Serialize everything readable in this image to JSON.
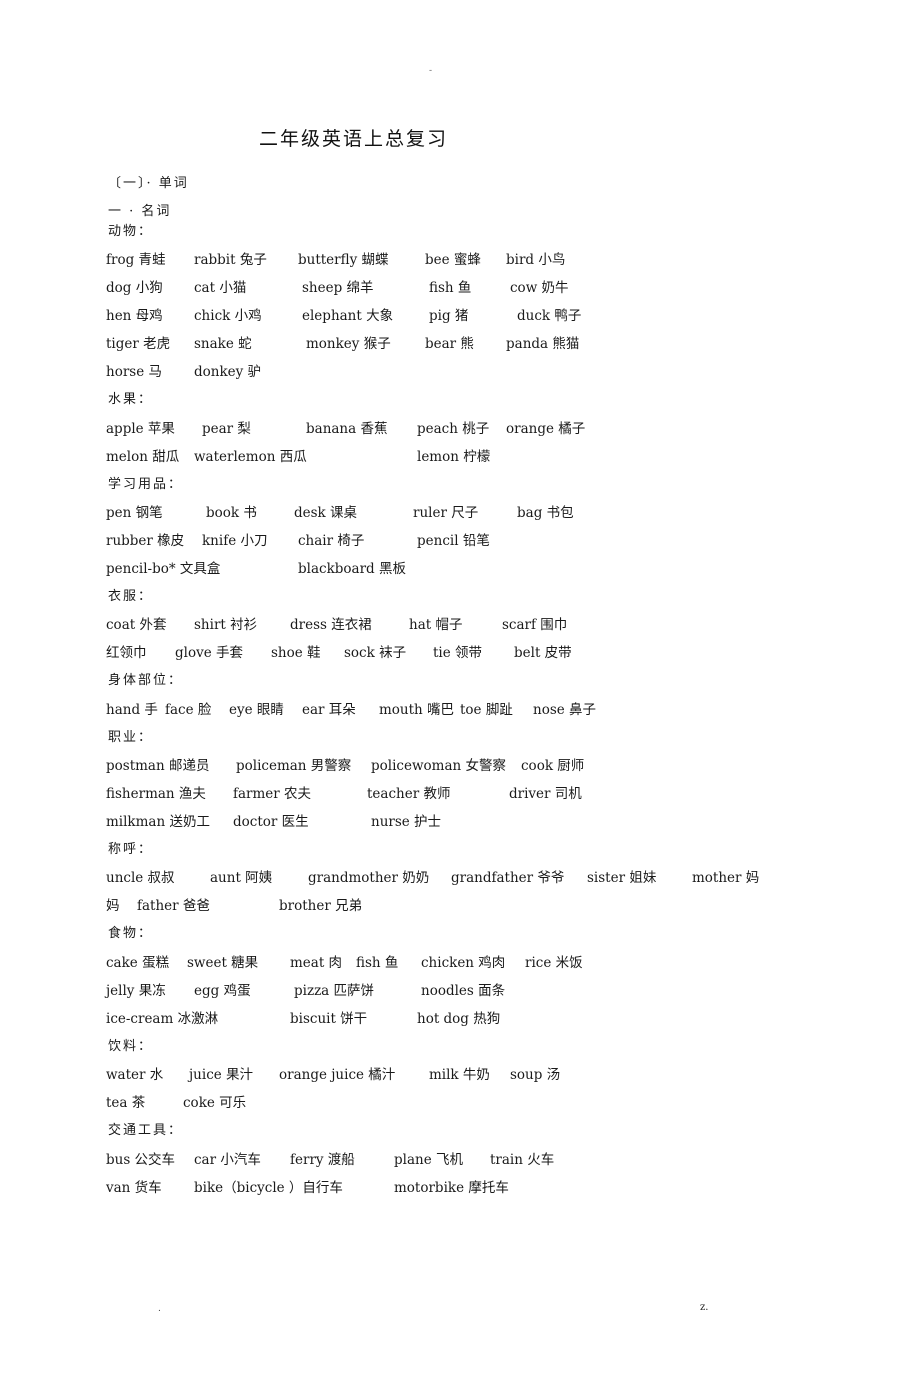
{
  "header_mark": "-",
  "title": "二年级英语上总复习",
  "section": "〔一〕· 单词",
  "subsection": "一 · 名词",
  "groups": [
    {
      "label": "动物：",
      "rows": [
        [
          "frog 青蛙",
          "rabbit 兔子",
          "butterfly 蝴蝶",
          "bee 蜜蜂",
          "bird 小鸟"
        ],
        [
          "dog 小狗",
          "cat  小猫",
          "sheep 绵羊",
          "fish 鱼",
          "cow  奶牛"
        ],
        [
          "hen 母鸡",
          "chick  小鸡",
          "elephant 大象",
          "pig 猪",
          "duck 鸭子"
        ],
        [
          "tiger 老虎",
          "snake 蛇",
          "monkey 猴子",
          "bear 熊",
          "panda 熊猫"
        ],
        [
          "horse 马",
          "donkey 驴"
        ]
      ]
    },
    {
      "label": "水果：",
      "rows": [
        [
          "apple 苹果",
          "pear 梨",
          "banana 香蕉",
          "peach 桃子",
          "orange 橘子"
        ],
        [
          "melon 甜瓜",
          "waterlemon  西瓜",
          "lemon 柠檬"
        ]
      ]
    },
    {
      "label": "学习用品：",
      "rows": [
        [
          "pen  钢笔",
          "book 书",
          "desk 课桌",
          "ruler 尺子",
          "bag 书包"
        ],
        [
          "rubber 橡皮",
          "knife 小刀",
          "chair 椅子",
          "pencil 铅笔"
        ],
        [
          "pencil-bo* 文具盒",
          "blackboard 黑板"
        ]
      ]
    },
    {
      "label": "衣服：",
      "rows": [
        [
          "coat 外套",
          "shirt 衬衫",
          "dress 连衣裙",
          "hat  帽子",
          "scarf 围巾"
        ],
        [
          "红领巾",
          "glove 手套",
          "shoe 鞋",
          "sock 袜子",
          "tie 领带",
          "belt 皮带"
        ]
      ]
    },
    {
      "label": "身体部位：",
      "rows": [
        [
          "hand 手",
          "face 脸",
          "eye 眼睛",
          "ear  耳朵",
          "mouth 嘴巴",
          "toe 脚趾",
          "nose 鼻子"
        ]
      ]
    },
    {
      "label": "职业：",
      "rows": [
        [
          "postman  邮递员",
          "policeman 男警察",
          "policewoman 女警察",
          "cook 厨师"
        ],
        [
          "fisherman 渔夫",
          "farmer 农夫",
          "teacher 教师",
          "driver 司机"
        ],
        [
          "milkman 送奶工",
          "doctor  医生",
          "nurse 护士"
        ]
      ]
    },
    {
      "label": "称呼：",
      "rows": [
        [
          "uncle 叔叔",
          "aunt 阿姨",
          "grandmother 奶奶",
          "grandfather 爷爷",
          "sister 姐妹",
          "mother 妈"
        ],
        [
          "妈",
          "father 爸爸",
          "brother 兄弟"
        ]
      ]
    },
    {
      "label": "食物：",
      "rows": [
        [
          "cake 蛋糕",
          "sweet 糖果",
          "meat 肉",
          "fish 鱼",
          "chicken 鸡肉",
          "rice 米饭"
        ],
        [
          "jelly 果冻",
          "egg  鸡蛋",
          "pizza 匹萨饼",
          "noodles 面条"
        ],
        [
          "ice-cream 冰激淋",
          "biscuit 饼干",
          "hot dog  热狗"
        ]
      ]
    },
    {
      "label": "饮料：",
      "rows": [
        [
          "water 水",
          "juice  果汁",
          "orange  juice 橘汁",
          "milk 牛奶",
          "soup  汤"
        ],
        [
          "tea  茶",
          "coke  可乐"
        ]
      ]
    },
    {
      "label": "交通工具：",
      "rows": [
        [
          "bus 公交车",
          "car 小汽车",
          "ferry 渡船",
          "plane 飞机",
          "train 火车"
        ],
        [
          "van 货车",
          "bike（bicycle ）自行车",
          "motorbike  摩托车"
        ]
      ]
    }
  ],
  "footer_left": ".",
  "footer_right": "z."
}
